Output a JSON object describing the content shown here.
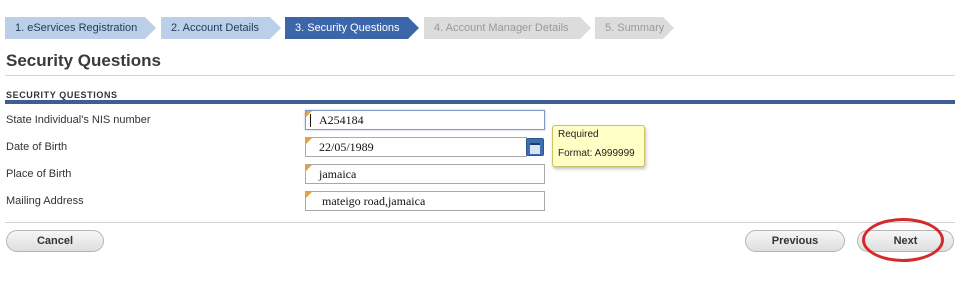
{
  "wizard": {
    "steps": [
      {
        "label": "1. eServices Registration",
        "state": "done"
      },
      {
        "label": "2. Account Details",
        "state": "done"
      },
      {
        "label": "3. Security Questions",
        "state": "active"
      },
      {
        "label": "4. Account Manager Details",
        "state": "todo"
      },
      {
        "label": "5. Summary",
        "state": "todo"
      }
    ]
  },
  "page": {
    "title": "Security Questions",
    "section_title": "SECURITY QUESTIONS"
  },
  "form": {
    "nis": {
      "label": "State Individual's NIS number",
      "value": "A254184"
    },
    "dob": {
      "label": "Date of Birth",
      "value": "22/05/1989"
    },
    "place_of_birth": {
      "label": "Place of Birth",
      "value": "jamaica"
    },
    "mailing_address": {
      "label": "Mailing Address",
      "value": "mateigo road,jamaica"
    }
  },
  "tooltip": {
    "line1": "Required",
    "line2": "Format: A999999"
  },
  "buttons": {
    "cancel": "Cancel",
    "previous": "Previous",
    "next": "Next"
  },
  "colors": {
    "step_done": "#bccfe8",
    "step_active": "#3c66aa",
    "step_todo": "#dcdcdc",
    "section_rule": "#3f5d95",
    "highlight_circle": "#d42a2a",
    "tooltip_bg": "#ffffc6"
  },
  "icons": {
    "calendar": "calendar-icon"
  }
}
